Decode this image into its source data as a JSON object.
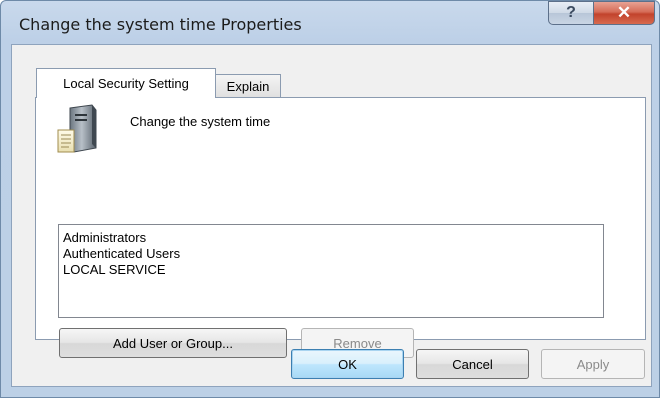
{
  "window": {
    "title": "Change the system time Properties",
    "help_glyph": "?",
    "close_glyph": "✕"
  },
  "tabs": [
    {
      "label": "Local Security Setting",
      "active": true
    },
    {
      "label": "Explain",
      "active": false
    }
  ],
  "policy": {
    "name": "Change the system time",
    "icon": "computer-tower-icon"
  },
  "principals": [
    "Administrators",
    "Authenticated Users",
    "LOCAL SERVICE"
  ],
  "buttons": {
    "add": "Add User or Group...",
    "remove": "Remove",
    "ok": "OK",
    "cancel": "Cancel",
    "apply": "Apply"
  },
  "colors": {
    "title_bar": "#bcd0e6",
    "close_button": "#c2432c",
    "default_button": "#bee6fd"
  }
}
